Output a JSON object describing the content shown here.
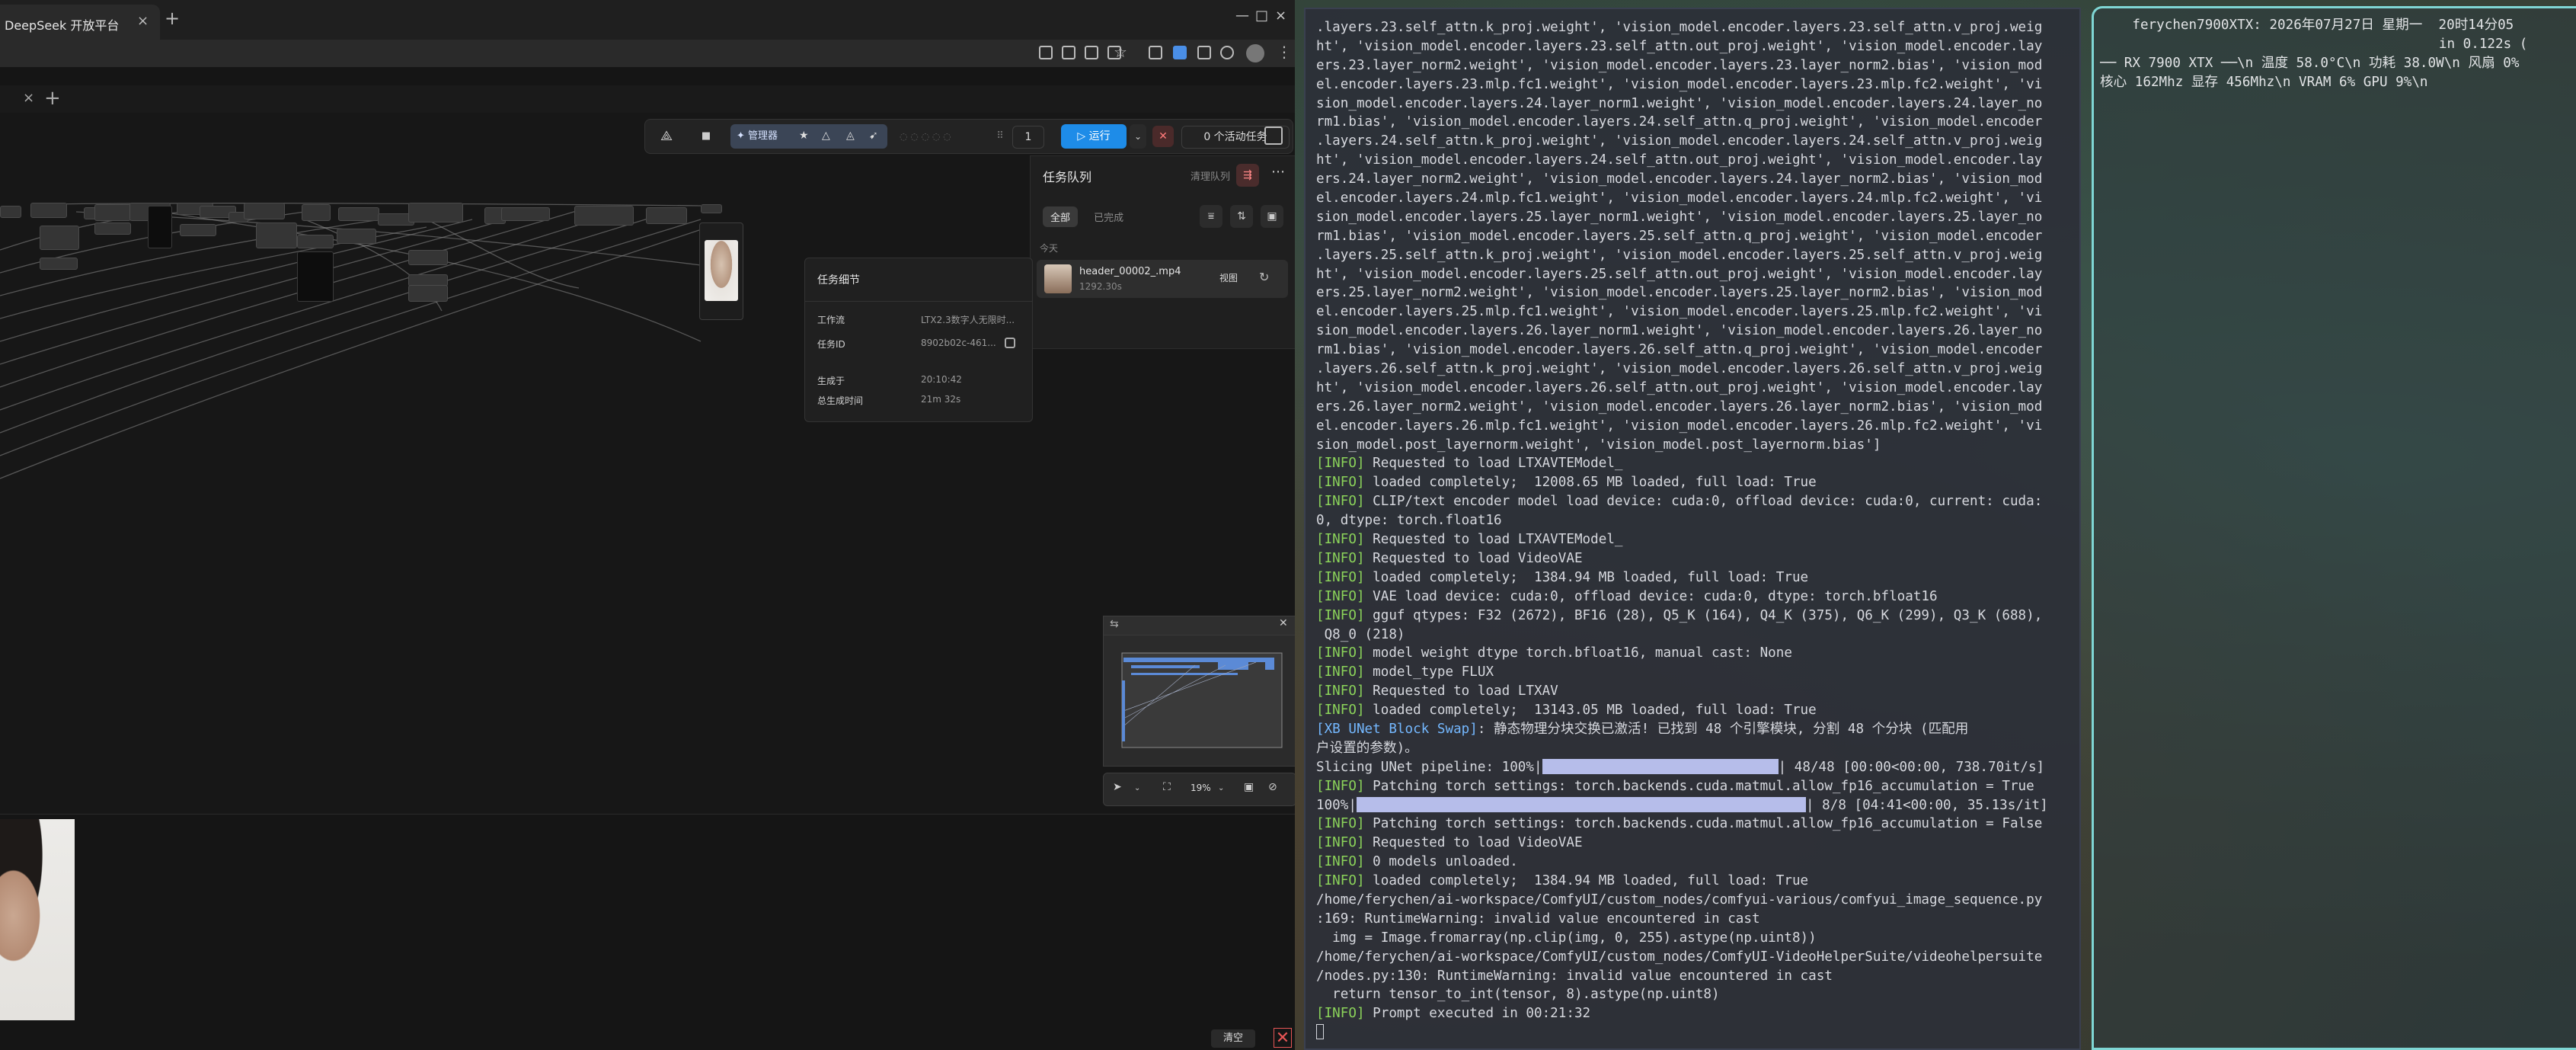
{
  "browser": {
    "tab_title": "DeepSeek 开放平台",
    "tab_close": "×",
    "new_tab": "+",
    "window_controls": [
      "—",
      "□",
      "×"
    ]
  },
  "comfy": {
    "workflow_tabs": {
      "close": "×",
      "add": "+"
    },
    "toolbar": {
      "manager_label": "管理器",
      "queue_count": "1",
      "run_label": "运行",
      "active_tasks": "0 个活动任务"
    },
    "queue_panel": {
      "title": "任务队列",
      "clear_label": "清理队列",
      "tab_all": "全部",
      "tab_done": "已完成",
      "section_today": "今天",
      "item": {
        "name": "header_00002_.mp4",
        "duration": "1292.30s",
        "view_label": "视图"
      }
    },
    "task_detail": {
      "title": "任务细节",
      "workflow_label": "工作流",
      "workflow_value": "LTX2.3数字人无限时...",
      "task_id_label": "任务ID",
      "task_id_value": "8902b02c-461...",
      "generated_label": "生成于",
      "generated_value": "20:10:42",
      "total_time_label": "总生成时间",
      "total_time_value": "21m 32s"
    },
    "zoom": {
      "value": "19%"
    },
    "gallery": {
      "clear_label": "清空"
    }
  },
  "terminal": {
    "lines": [
      {
        "t": "plain",
        "text": ".layers.23.self_attn.k_proj.weight', 'vision_model.encoder.layers.23.self_attn.v_proj.weig"
      },
      {
        "t": "plain",
        "text": "ht', 'vision_model.encoder.layers.23.self_attn.out_proj.weight', 'vision_model.encoder.lay"
      },
      {
        "t": "plain",
        "text": "ers.23.layer_norm2.weight', 'vision_model.encoder.layers.23.layer_norm2.bias', 'vision_mod"
      },
      {
        "t": "plain",
        "text": "el.encoder.layers.23.mlp.fc1.weight', 'vision_model.encoder.layers.23.mlp.fc2.weight', 'vi"
      },
      {
        "t": "plain",
        "text": "sion_model.encoder.layers.24.layer_norm1.weight', 'vision_model.encoder.layers.24.layer_no"
      },
      {
        "t": "plain",
        "text": "rm1.bias', 'vision_model.encoder.layers.24.self_attn.q_proj.weight', 'vision_model.encoder"
      },
      {
        "t": "plain",
        "text": ".layers.24.self_attn.k_proj.weight', 'vision_model.encoder.layers.24.self_attn.v_proj.weig"
      },
      {
        "t": "plain",
        "text": "ht', 'vision_model.encoder.layers.24.self_attn.out_proj.weight', 'vision_model.encoder.lay"
      },
      {
        "t": "plain",
        "text": "ers.24.layer_norm2.weight', 'vision_model.encoder.layers.24.layer_norm2.bias', 'vision_mod"
      },
      {
        "t": "plain",
        "text": "el.encoder.layers.24.mlp.fc1.weight', 'vision_model.encoder.layers.24.mlp.fc2.weight', 'vi"
      },
      {
        "t": "plain",
        "text": "sion_model.encoder.layers.25.layer_norm1.weight', 'vision_model.encoder.layers.25.layer_no"
      },
      {
        "t": "plain",
        "text": "rm1.bias', 'vision_model.encoder.layers.25.self_attn.q_proj.weight', 'vision_model.encoder"
      },
      {
        "t": "plain",
        "text": ".layers.25.self_attn.k_proj.weight', 'vision_model.encoder.layers.25.self_attn.v_proj.weig"
      },
      {
        "t": "plain",
        "text": "ht', 'vision_model.encoder.layers.25.self_attn.out_proj.weight', 'vision_model.encoder.lay"
      },
      {
        "t": "plain",
        "text": "ers.25.layer_norm2.weight', 'vision_model.encoder.layers.25.layer_norm2.bias', 'vision_mod"
      },
      {
        "t": "plain",
        "text": "el.encoder.layers.25.mlp.fc1.weight', 'vision_model.encoder.layers.25.mlp.fc2.weight', 'vi"
      },
      {
        "t": "plain",
        "text": "sion_model.encoder.layers.26.layer_norm1.weight', 'vision_model.encoder.layers.26.layer_no"
      },
      {
        "t": "plain",
        "text": "rm1.bias', 'vision_model.encoder.layers.26.self_attn.q_proj.weight', 'vision_model.encoder"
      },
      {
        "t": "plain",
        "text": ".layers.26.self_attn.k_proj.weight', 'vision_model.encoder.layers.26.self_attn.v_proj.weig"
      },
      {
        "t": "plain",
        "text": "ht', 'vision_model.encoder.layers.26.self_attn.out_proj.weight', 'vision_model.encoder.lay"
      },
      {
        "t": "plain",
        "text": "ers.26.layer_norm2.weight', 'vision_model.encoder.layers.26.layer_norm2.bias', 'vision_mod"
      },
      {
        "t": "plain",
        "text": "el.encoder.layers.26.mlp.fc1.weight', 'vision_model.encoder.layers.26.mlp.fc2.weight', 'vi"
      },
      {
        "t": "plain",
        "text": "sion_model.post_layernorm.weight', 'vision_model.post_layernorm.bias']"
      },
      {
        "t": "info",
        "text": " Requested to load LTXAVTEModel_"
      },
      {
        "t": "info",
        "text": " loaded completely;  12008.65 MB loaded, full load: True"
      },
      {
        "t": "info",
        "text": " CLIP/text encoder model load device: cuda:0, offload device: cuda:0, current: cuda:"
      },
      {
        "t": "plain",
        "text": "0, dtype: torch.float16"
      },
      {
        "t": "info",
        "text": " Requested to load LTXAVTEModel_"
      },
      {
        "t": "info",
        "text": " Requested to load VideoVAE"
      },
      {
        "t": "info",
        "text": " loaded completely;  1384.94 MB loaded, full load: True"
      },
      {
        "t": "info",
        "text": " VAE load device: cuda:0, offload device: cuda:0, dtype: torch.bfloat16"
      },
      {
        "t": "info",
        "text": " gguf qtypes: F32 (2672), BF16 (28), Q5_K (164), Q4_K (375), Q6_K (299), Q3_K (688),"
      },
      {
        "t": "plain",
        "text": " Q8_0 (218)"
      },
      {
        "t": "info",
        "text": " model weight dtype torch.bfloat16, manual cast: None"
      },
      {
        "t": "info",
        "text": " model_type FLUX"
      },
      {
        "t": "info",
        "text": " Requested to load LTXAV"
      },
      {
        "t": "info",
        "text": " loaded completely;  13143.05 MB loaded, full load: True"
      },
      {
        "t": "xb",
        "tag": "[XB UNet Block Swap]",
        "text": ": 静态物理分块交换已激活! 已找到 48 个引擎模块, 分割 48 个分块 (匹配用"
      },
      {
        "t": "plain",
        "text": "户设置的参数)。"
      },
      {
        "t": "bar1",
        "pre": "Slicing UNet pipeline: 100%|",
        "post": "| 48/48 [00:00<00:00, 738.70it/s]"
      },
      {
        "t": "info",
        "text": " Patching torch settings: torch.backends.cuda.matmul.allow_fp16_accumulation = True"
      },
      {
        "t": "bar2",
        "pre": "100%|",
        "post": "| 8/8 [04:41<00:00, 35.13s/it]"
      },
      {
        "t": "info",
        "text": " Patching torch settings: torch.backends.cuda.matmul.allow_fp16_accumulation = False"
      },
      {
        "t": "info",
        "text": " Requested to load VideoVAE"
      },
      {
        "t": "info",
        "text": " 0 models unloaded."
      },
      {
        "t": "info",
        "text": " loaded completely;  1384.94 MB loaded, full load: True"
      },
      {
        "t": "plain",
        "text": "/home/ferychen/ai-workspace/ComfyUI/custom_nodes/comfyui-various/comfyui_image_sequence.py"
      },
      {
        "t": "plain",
        "text": ":169: RuntimeWarning: invalid value encountered in cast"
      },
      {
        "t": "plain",
        "text": "  img = Image.fromarray(np.clip(img, 0, 255).astype(np.uint8))"
      },
      {
        "t": "plain",
        "text": "/home/ferychen/ai-workspace/ComfyUI/custom_nodes/ComfyUI-VideoHelperSuite/videohelpersuite"
      },
      {
        "t": "plain",
        "text": "/nodes.py:130: RuntimeWarning: invalid value encountered in cast"
      },
      {
        "t": "plain",
        "text": "  return tensor_to_int(tensor, 8).astype(np.uint8)"
      },
      {
        "t": "info",
        "text": " Prompt executed in 00:21:32"
      },
      {
        "t": "cursor",
        "text": ""
      }
    ],
    "info_tag": "[INFO]"
  },
  "monitor": {
    "lines": [
      "    ferychen7900XTX: 2026年07月27日 星期一  20时14分05",
      "                                          in 0.122s (",
      "── RX 7900 XTX ──\\n 温度 58.0°C\\n 功耗 38.0W\\n 风扇 0%",
      "核心 162Mhz 显存 456Mhz\\n VRAM 6% GPU 9%\\n"
    ]
  },
  "colors": {
    "run_button": "#1e8ce8",
    "info_tag": "#8bd35a",
    "progress_bar": "#b6bdea",
    "monitor_border": "#7fd6d4"
  },
  "icons": [
    "bookmark-icon",
    "star-icon",
    "logo-icon",
    "filter-icon",
    "sort-icon",
    "image-icon",
    "refresh-icon",
    "copy-icon",
    "fit-view-icon",
    "pointer-icon",
    "minimap-icon",
    "close-icon"
  ]
}
